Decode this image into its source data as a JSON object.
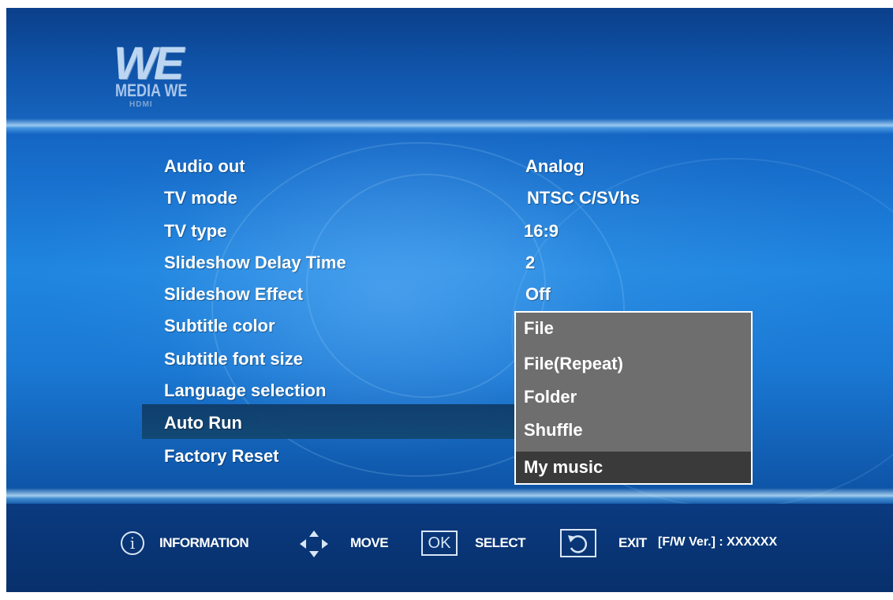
{
  "logo": {
    "brand": "WE",
    "subtitle": "MEDIA WE",
    "hdmi": "HDMI"
  },
  "settings": [
    {
      "label": "Audio out",
      "value": "Analog"
    },
    {
      "label": "TV mode",
      "value": "NTSC C/SVhs"
    },
    {
      "label": "TV type",
      "value": "16:9"
    },
    {
      "label": "Slideshow Delay Time",
      "value": "2"
    },
    {
      "label": "Slideshow Effect",
      "value": "Off"
    },
    {
      "label": "Subtitle color",
      "value": ""
    },
    {
      "label": "Subtitle font size",
      "value": ""
    },
    {
      "label": "Language selection",
      "value": ""
    },
    {
      "label": "Auto Run",
      "value": ""
    },
    {
      "label": "Factory Reset",
      "value": ""
    }
  ],
  "selected_setting": "Auto Run",
  "dropdown": {
    "options": [
      "File",
      "File(Repeat)",
      "Folder",
      "Shuffle",
      "My music"
    ],
    "selected": "My music"
  },
  "footer": {
    "information_label": "INFORMATION",
    "move_label": "MOVE",
    "ok_icon_text": "OK",
    "select_label": "SELECT",
    "exit_label": "EXIT",
    "firmware": "[F/W Ver.] : XXXXXX"
  },
  "icons": [
    "info-icon",
    "move-arrows-icon",
    "ok-icon",
    "back-icon"
  ],
  "colors": {
    "background_blue": "#1f86e0",
    "highlight": "#12466f",
    "dropdown_bg": "#6e6e6e",
    "dropdown_selected": "#3a3a3a",
    "text": "#ffffff"
  }
}
